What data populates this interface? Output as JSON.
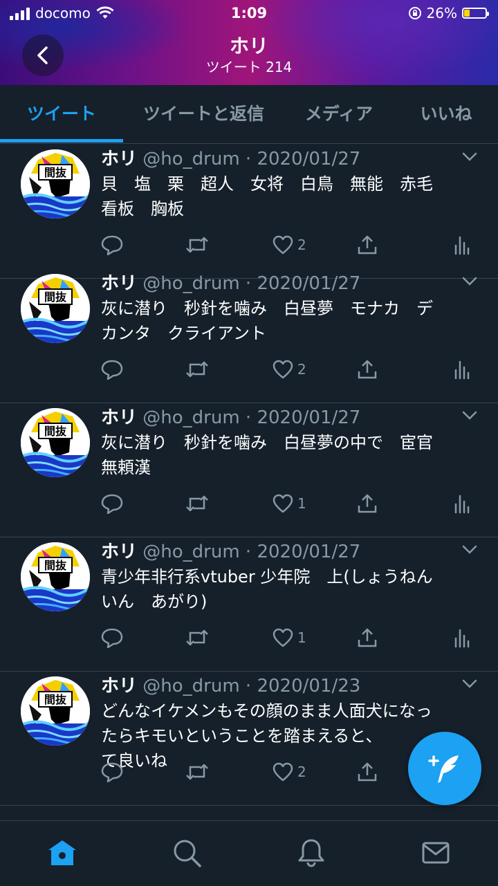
{
  "status": {
    "carrier": "docomo",
    "time": "1:09",
    "battery": "26%",
    "battery_level": 0.26
  },
  "header": {
    "title": "ホリ",
    "subtitle": "ツイート 214"
  },
  "tabs": [
    {
      "label": "ツイート",
      "active": true
    },
    {
      "label": "ツイートと返信",
      "active": false
    },
    {
      "label": "メディア",
      "active": false
    },
    {
      "label": "いいね",
      "active": false
    }
  ],
  "tweets": [
    {
      "name": "ホリ",
      "handle": "@ho_drum",
      "date": "2020/01/27",
      "text": "貝　塩　栗　超人　女将　白鳥　無能　赤毛\n看板　胸板",
      "likes": "2"
    },
    {
      "name": "ホリ",
      "handle": "@ho_drum",
      "date": "2020/01/27",
      "text": "灰に潜り　秒針を噛み　白昼夢　モナカ　デ\nカンタ　クライアント",
      "likes": "2"
    },
    {
      "name": "ホリ",
      "handle": "@ho_drum",
      "date": "2020/01/27",
      "text": "灰に潜り　秒針を噛み　白昼夢の中で　宦官\n無頼漢",
      "likes": "1"
    },
    {
      "name": "ホリ",
      "handle": "@ho_drum",
      "date": "2020/01/27",
      "text": "青少年非行系vtuber 少年院　上(しょうねん\nいん　あがり)",
      "likes": "1"
    },
    {
      "name": "ホリ",
      "handle": "@ho_drum",
      "date": "2020/01/23",
      "text": "どんなイケメンもその顔のまま人面犬になっ\nたらキモいということを踏まえると、\nて良いね",
      "likes": "2"
    }
  ],
  "avatar_text": "間抜",
  "nav": [
    "home-icon",
    "search-icon",
    "bell-icon",
    "mail-icon"
  ],
  "colors": {
    "accent": "#1da1f2",
    "background": "#15202b",
    "muted": "#8899a6"
  }
}
